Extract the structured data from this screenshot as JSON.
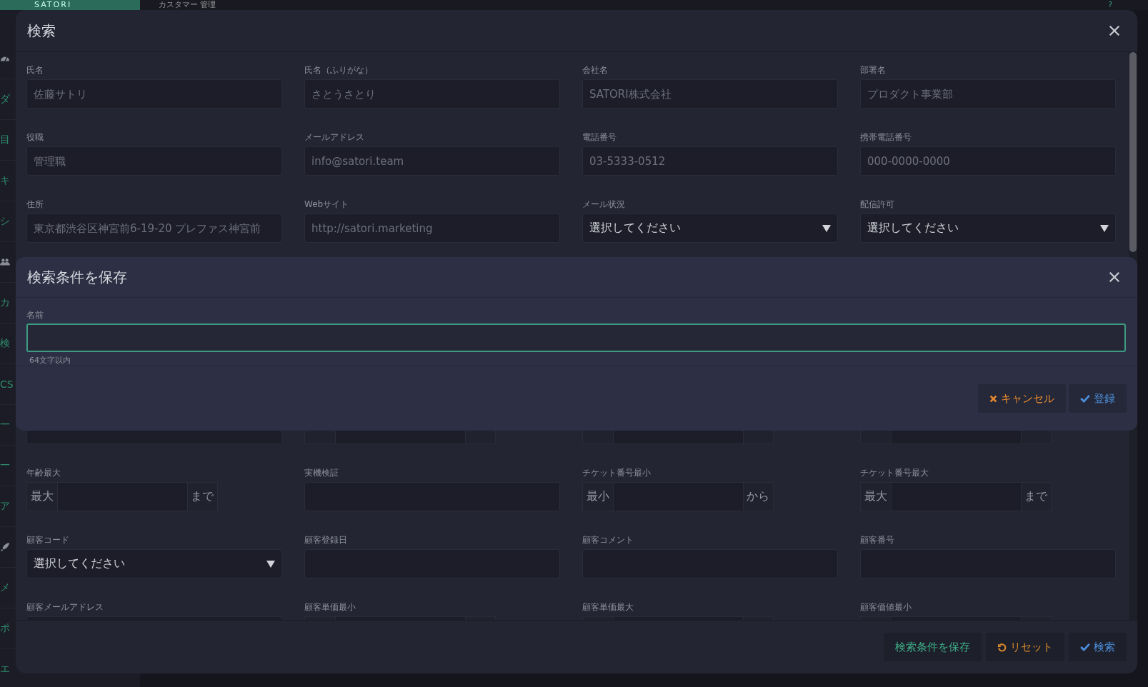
{
  "topbar": {
    "logo": "SATORI",
    "title": "カスタマー 管理",
    "help": "?"
  },
  "sidebar": {
    "items": [
      {
        "kind": "gauge"
      },
      {
        "kind": "text",
        "label": "ダ"
      },
      {
        "kind": "text",
        "label": "目"
      },
      {
        "kind": "text",
        "label": "キ"
      },
      {
        "kind": "text",
        "label": "シ"
      },
      {
        "kind": "users"
      },
      {
        "kind": "text",
        "label": "カ"
      },
      {
        "kind": "text",
        "label": "検"
      },
      {
        "kind": "text",
        "label": "CS"
      },
      {
        "kind": "text",
        "label": "一"
      },
      {
        "kind": "text",
        "label": "一"
      },
      {
        "kind": "text",
        "label": "ア"
      },
      {
        "kind": "rocket"
      },
      {
        "kind": "text",
        "label": "メ"
      },
      {
        "kind": "text",
        "label": "ポ"
      },
      {
        "kind": "text",
        "label": "エ"
      }
    ]
  },
  "search_modal": {
    "title": "検索",
    "fields": [
      {
        "label": "氏名",
        "kind": "text",
        "placeholder": "佐藤サトリ"
      },
      {
        "label": "氏名（ふりがな）",
        "kind": "text",
        "placeholder": "さとうさとり"
      },
      {
        "label": "会社名",
        "kind": "text",
        "placeholder": "SATORI株式会社"
      },
      {
        "label": "部署名",
        "kind": "text",
        "placeholder": "プロダクト事業部"
      },
      {
        "label": "役職",
        "kind": "text",
        "placeholder": "管理職"
      },
      {
        "label": "メールアドレス",
        "kind": "text",
        "placeholder": "info@satori.team"
      },
      {
        "label": "電話番号",
        "kind": "text",
        "placeholder": "03-5333-0512"
      },
      {
        "label": "携帯電話番号",
        "kind": "text",
        "placeholder": "000-0000-0000"
      },
      {
        "label": "住所",
        "kind": "text",
        "placeholder": "東京都渋谷区神宮前6-19-20 プレファス神宮前"
      },
      {
        "label": "Webサイト",
        "kind": "text",
        "placeholder": "http://satori.marketing"
      },
      {
        "label": "メール状況",
        "kind": "select",
        "value": "選択してください"
      },
      {
        "label": "配信許可",
        "kind": "select",
        "value": "選択してください"
      },
      {
        "kind": "hidden"
      },
      {
        "kind": "hidden"
      },
      {
        "kind": "hidden"
      },
      {
        "kind": "hidden"
      },
      {
        "kind": "hidden"
      },
      {
        "kind": "hidden"
      },
      {
        "kind": "hidden"
      },
      {
        "kind": "hidden"
      },
      {
        "kind": "covered_select"
      },
      {
        "kind": "covered_range"
      },
      {
        "kind": "covered_range"
      },
      {
        "kind": "covered_range"
      },
      {
        "label": "年齢最大",
        "kind": "range",
        "prefix": "最大",
        "suffix": "まで"
      },
      {
        "label": "実機検証",
        "kind": "text"
      },
      {
        "label": "チケット番号最小",
        "kind": "range",
        "prefix": "最小",
        "suffix": "から"
      },
      {
        "label": "チケット番号最大",
        "kind": "range",
        "prefix": "最大",
        "suffix": "まで"
      },
      {
        "label": "顧客コード",
        "kind": "select",
        "value": "選択してください"
      },
      {
        "label": "顧客登録日",
        "kind": "text"
      },
      {
        "label": "顧客コメント",
        "kind": "text"
      },
      {
        "label": "顧客番号",
        "kind": "text"
      },
      {
        "label": "顧客メールアドレス",
        "kind": "text"
      },
      {
        "label": "顧客単価最小",
        "kind": "range_cut"
      },
      {
        "label": "顧客単価最大",
        "kind": "range_cut"
      },
      {
        "label": "顧客価値最小",
        "kind": "range_cut"
      }
    ],
    "buttons": [
      {
        "kind": "save",
        "label": "検索条件を保存"
      },
      {
        "kind": "reset",
        "label": "リセット"
      },
      {
        "kind": "search",
        "label": "検索"
      }
    ]
  },
  "save_dialog": {
    "title": "検索条件を保存",
    "field": {
      "label": "名前",
      "focused": true,
      "hint": "64文字以内"
    },
    "buttons": [
      {
        "kind": "cancel",
        "label": "キャンセル"
      },
      {
        "kind": "register",
        "label": "登録"
      }
    ]
  }
}
